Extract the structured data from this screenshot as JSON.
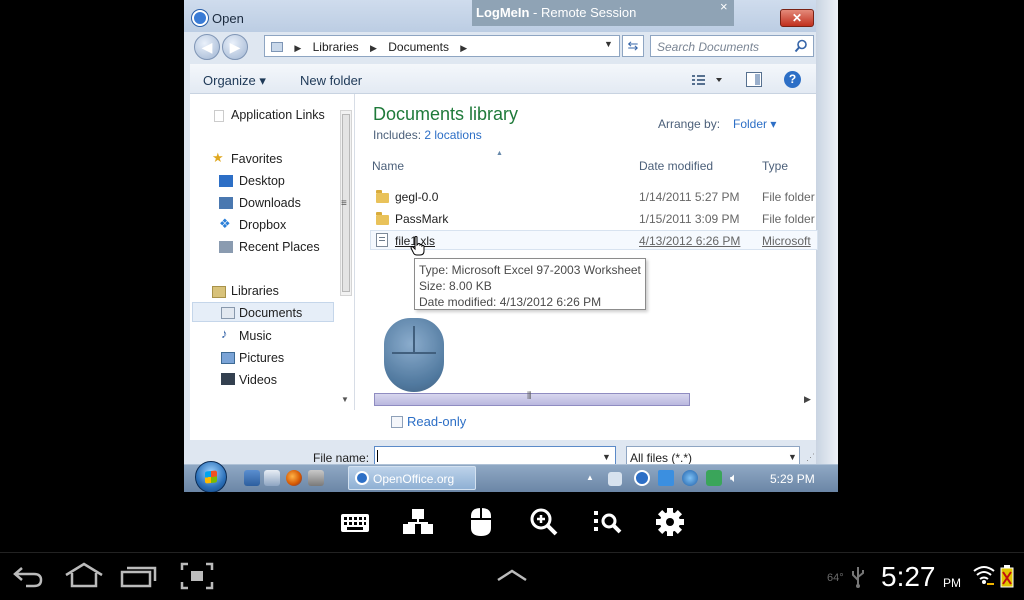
{
  "remote_window": {
    "title": "Open",
    "banner_app": "LogMeIn",
    "banner_suffix": " - Remote Session",
    "banner_close": "×",
    "close_glyph": "✕"
  },
  "nav": {
    "breadcrumb": [
      "Libraries",
      "Documents"
    ],
    "search_placeholder": "Search Documents"
  },
  "toolbar": {
    "organize": "Organize ▾",
    "new_folder": "New folder"
  },
  "sidebar": {
    "application_links": "Application Links",
    "favorites": "Favorites",
    "desktop": "Desktop",
    "downloads": "Downloads",
    "dropbox": "Dropbox",
    "recent_places": "Recent Places",
    "libraries": "Libraries",
    "documents": "Documents",
    "music": "Music",
    "pictures": "Pictures",
    "videos": "Videos"
  },
  "library": {
    "title": "Documents library",
    "includes_label": "Includes:",
    "includes_link": "2 locations",
    "arrange_label": "Arrange by:",
    "arrange_value": "Folder ▾"
  },
  "columns": {
    "name": "Name",
    "date": "Date modified",
    "type": "Type"
  },
  "files": [
    {
      "name": "gegl-0.0",
      "date": "1/14/2011 5:27 PM",
      "type": "File folder"
    },
    {
      "name": "PassMark",
      "date": "1/15/2011 3:09 PM",
      "type": "File folder"
    },
    {
      "name": "file1.xls",
      "date": "4/13/2012 6:26 PM",
      "type": "Microsoft"
    }
  ],
  "tooltip": {
    "line1": "Type: Microsoft Excel 97-2003 Worksheet",
    "line2": "Size: 8.00 KB",
    "line3": "Date modified: 4/13/2012 6:26 PM"
  },
  "footer": {
    "readonly": "Read-only",
    "filename_label": "File name:",
    "filename_value": "",
    "filetype": "All files (*.*)"
  },
  "taskbar": {
    "task_label": "OpenOffice.org",
    "clock": "5:29 PM"
  },
  "android": {
    "temperature": "64°",
    "time": "5:27",
    "ampm": "PM"
  },
  "colors": {
    "library_title": "#1f7a3a",
    "link": "#2d6fc6"
  }
}
